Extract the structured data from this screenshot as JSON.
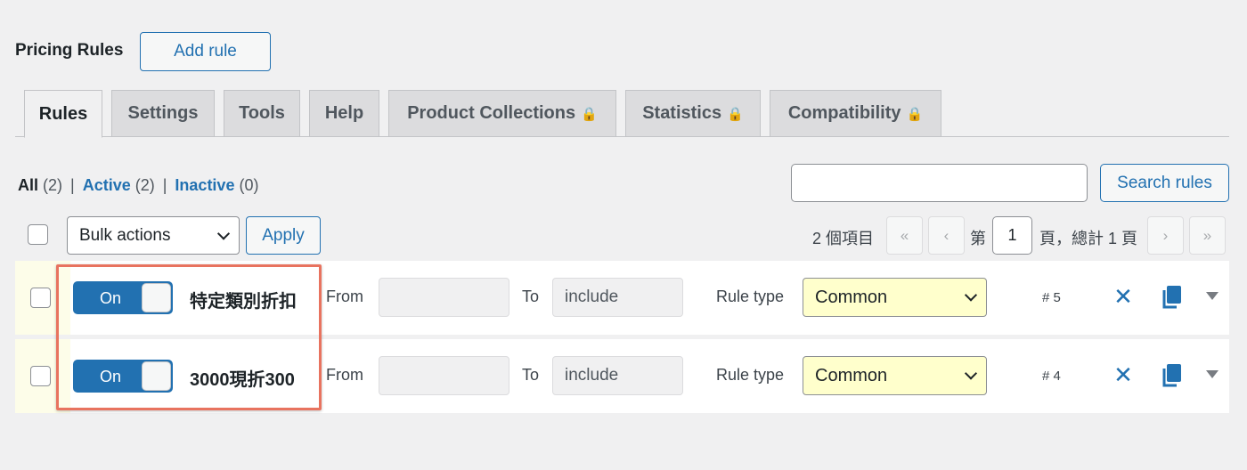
{
  "header": {
    "title": "Pricing Rules",
    "add_label": "Add rule"
  },
  "tabs": [
    {
      "label": "Rules",
      "locked": false
    },
    {
      "label": "Settings",
      "locked": false
    },
    {
      "label": "Tools",
      "locked": false
    },
    {
      "label": "Help",
      "locked": false
    },
    {
      "label": "Product Collections",
      "locked": true
    },
    {
      "label": "Statistics",
      "locked": true
    },
    {
      "label": "Compatibility",
      "locked": true
    }
  ],
  "filters": {
    "all_label": "All",
    "all_count": "(2)",
    "active_label": "Active",
    "active_count": "(2)",
    "inactive_label": "Inactive",
    "inactive_count": "(0)",
    "separator": "|"
  },
  "search": {
    "placeholder": "",
    "button_label": "Search rules"
  },
  "bulk": {
    "selected": "Bulk actions",
    "apply_label": "Apply"
  },
  "pagination": {
    "items_text": "2 個項目",
    "first": "«",
    "prev": "‹",
    "next": "›",
    "last": "»",
    "page_prefix": "第",
    "current_page": "1",
    "page_suffix": "頁，總計 1 頁"
  },
  "rows": [
    {
      "toggle": "On",
      "name": "特定類別折扣",
      "from_label": "From",
      "from_value": "",
      "to_label": "To",
      "to_value": "include",
      "type_label": "Rule type",
      "type_value": "Common",
      "id": "# 5"
    },
    {
      "toggle": "On",
      "name": "3000現折300",
      "from_label": "From",
      "from_value": "",
      "to_label": "To",
      "to_value": "include",
      "type_label": "Rule type",
      "type_value": "Common",
      "id": "# 4"
    }
  ],
  "icons": {
    "delete": "close-icon",
    "copy": "copy-icon",
    "expand": "caret-down-icon",
    "lock": "lock-icon"
  },
  "colors": {
    "accent": "#2271b1",
    "highlight": "#e8735f",
    "select_bg": "#ffffcc"
  }
}
